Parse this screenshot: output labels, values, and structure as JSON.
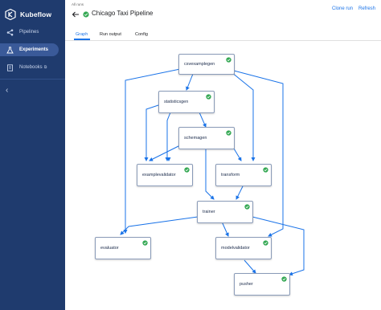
{
  "app": {
    "brand": "Kubeflow"
  },
  "sidebar": {
    "items": [
      {
        "label": "Pipelines",
        "icon": "pipelines-icon"
      },
      {
        "label": "Experiments",
        "icon": "experiments-icon",
        "active": true
      },
      {
        "label": "Notebooks",
        "icon": "notebooks-icon",
        "external": "⧉"
      }
    ],
    "collapse_glyph": "‹"
  },
  "header": {
    "breadcrumb": "All runs",
    "title": "Chicago Taxi Pipeline",
    "clone_run": "Clone run",
    "refresh": "Refresh"
  },
  "tabs": [
    {
      "label": "Graph",
      "active": true
    },
    {
      "label": "Run output"
    },
    {
      "label": "Config"
    }
  ],
  "graph": {
    "nodes": [
      {
        "id": "csvexamplegen",
        "label": "csvexamplegen",
        "status": "succeeded"
      },
      {
        "id": "statisticsgen",
        "label": "statisticsgen",
        "status": "succeeded"
      },
      {
        "id": "schemagen",
        "label": "schemagen",
        "status": "succeeded"
      },
      {
        "id": "examplevalidator",
        "label": "examplevalidator",
        "status": "succeeded"
      },
      {
        "id": "transform",
        "label": "transform",
        "status": "succeeded"
      },
      {
        "id": "trainer",
        "label": "trainer",
        "status": "succeeded"
      },
      {
        "id": "evaluator",
        "label": "evaluator",
        "status": "succeeded"
      },
      {
        "id": "modelvalidator",
        "label": "modelvalidator",
        "status": "succeeded"
      },
      {
        "id": "pusher",
        "label": "pusher",
        "status": "succeeded"
      }
    ]
  },
  "colors": {
    "sidebar_bg": "#1f3b6e",
    "accent": "#1a73e8",
    "success": "#34a853",
    "edge": "#1a73e8"
  }
}
